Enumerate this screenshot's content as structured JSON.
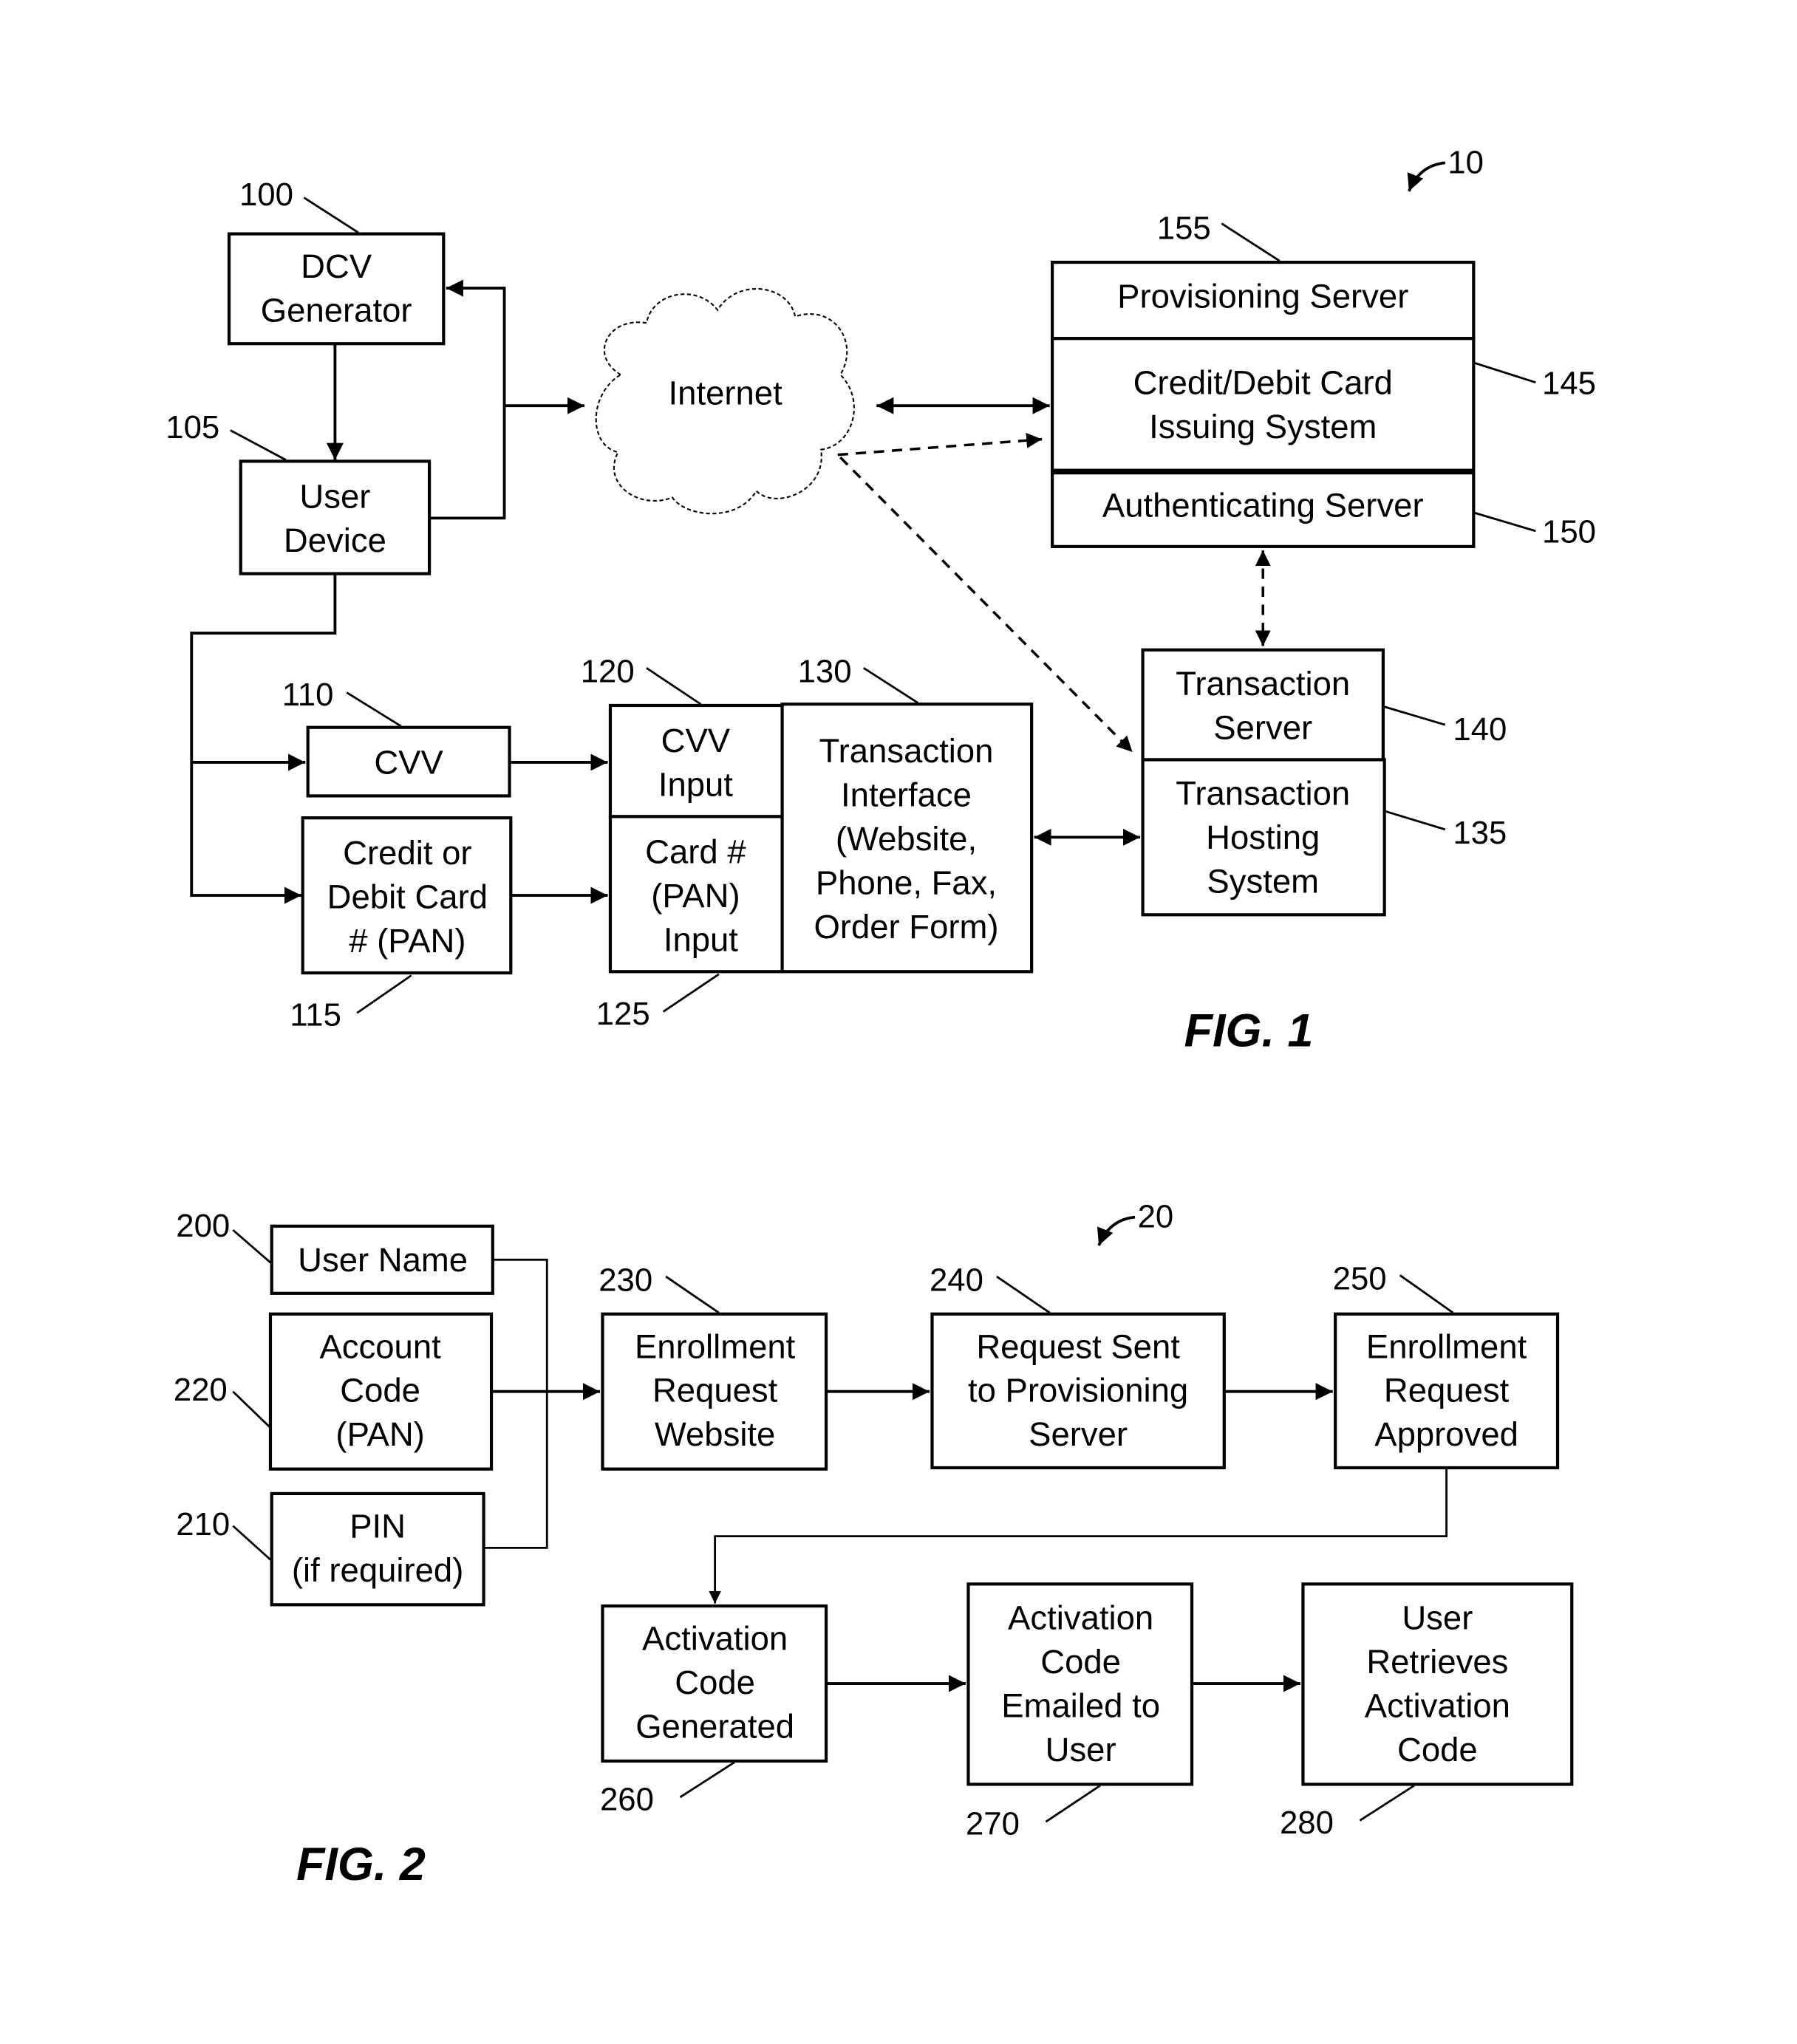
{
  "figures": [
    {
      "caption": "FIG. 1",
      "ref": "10",
      "blocks": {
        "dcv_generator": {
          "ref": "100",
          "lines": [
            "DCV",
            "Generator"
          ]
        },
        "user_device": {
          "ref": "105",
          "lines": [
            "User",
            "Device"
          ]
        },
        "internet": {
          "lines": [
            "Internet"
          ]
        },
        "provisioning_server": {
          "ref": "155",
          "lines": [
            "Provisioning Server"
          ]
        },
        "issuing_system": {
          "ref": "145",
          "lines": [
            "Credit/Debit Card",
            "Issuing System"
          ]
        },
        "authenticating_server": {
          "ref": "150",
          "lines": [
            "Authenticating Server"
          ]
        },
        "cvv": {
          "ref": "110",
          "lines": [
            "CVV"
          ]
        },
        "pan": {
          "ref": "115",
          "lines": [
            "Credit or",
            "Debit Card",
            "# (PAN)"
          ]
        },
        "cvv_input": {
          "ref": "120",
          "lines": [
            "CVV",
            "Input"
          ]
        },
        "pan_input": {
          "ref": "125",
          "lines": [
            "Card #",
            "(PAN)",
            "Input"
          ]
        },
        "transaction_interface": {
          "ref": "130",
          "lines": [
            "Transaction",
            "Interface",
            "(Website,",
            "Phone, Fax,",
            "Order Form)"
          ]
        },
        "transaction_server": {
          "ref": "140",
          "lines": [
            "Transaction",
            "Server"
          ]
        },
        "transaction_hosting": {
          "ref": "135",
          "lines": [
            "Transaction",
            "Hosting",
            "System"
          ]
        }
      }
    },
    {
      "caption": "FIG. 2",
      "ref": "20",
      "blocks": {
        "user_name": {
          "ref": "200",
          "lines": [
            "User Name"
          ]
        },
        "account_code": {
          "ref": "220",
          "lines": [
            "Account",
            "Code",
            "(PAN)"
          ]
        },
        "pin": {
          "ref": "210",
          "lines": [
            "PIN",
            "(if required)"
          ]
        },
        "enrollment_website": {
          "ref": "230",
          "lines": [
            "Enrollment",
            "Request",
            "Website"
          ]
        },
        "request_sent": {
          "ref": "240",
          "lines": [
            "Request Sent",
            "to Provisioning",
            "Server"
          ]
        },
        "request_approved": {
          "ref": "250",
          "lines": [
            "Enrollment",
            "Request",
            "Approved"
          ]
        },
        "code_generated": {
          "ref": "260",
          "lines": [
            "Activation",
            "Code",
            "Generated"
          ]
        },
        "code_emailed": {
          "ref": "270",
          "lines": [
            "Activation",
            "Code",
            "Emailed to",
            "User"
          ]
        },
        "user_retrieves": {
          "ref": "280",
          "lines": [
            "User",
            "Retrieves",
            "Activation",
            "Code"
          ]
        }
      }
    }
  ]
}
